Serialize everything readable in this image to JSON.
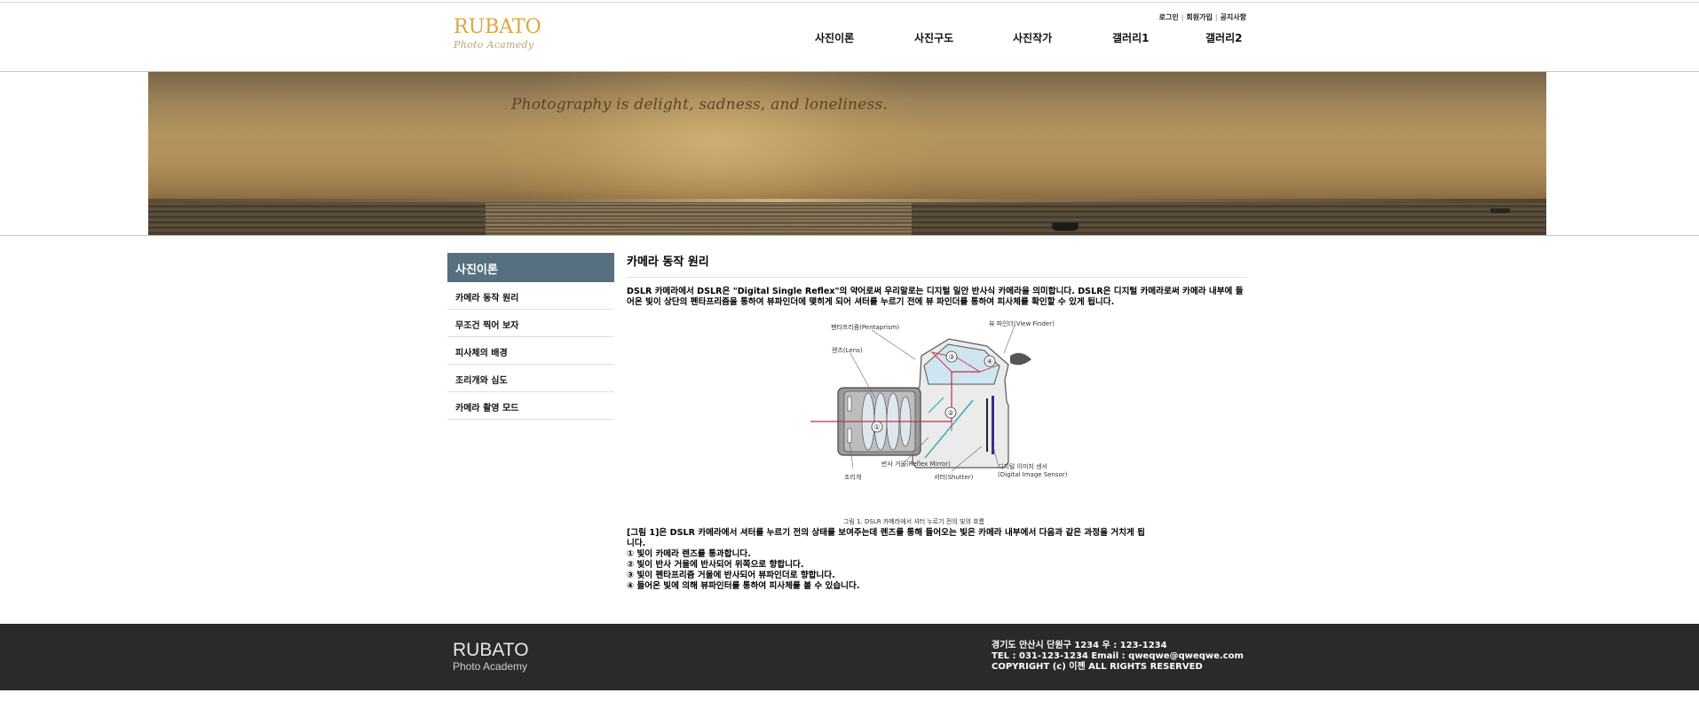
{
  "header": {
    "logo_main": "RUBATO",
    "logo_sub": "Photo Acamedy",
    "util_links": [
      "로그인",
      "회원가입",
      "공지사항"
    ],
    "nav": [
      "사진이론",
      "사진구도",
      "사진작가",
      "갤러리1",
      "갤러리2"
    ]
  },
  "banner": {
    "quote": "Photography is delight, sadness, and loneliness."
  },
  "sidebar": {
    "title": "사진이론",
    "items": [
      "카메라 동작 원리",
      "무조건 찍어 보자",
      "피사체의 배경",
      "조리개와 심도",
      "카메라 촬영 모드"
    ]
  },
  "main": {
    "title": "카메라 동작 원리",
    "intro": "DSLR 카메라에서 DSLR은 \"Digital Single Reflex\"의 약어로써 우리말로는 디지털 일안 반사식 카메라을 의미합니다. DSLR은 디지털 카메라로써 카메라 내부에 들어온 빛이 상단의 펜타프리즘을 통하여 뷰파인더에 맺히게 되어 셔터를 누르기 전에 뷰 파인더를 통하여 피사체를 확인할 수 있게 됩니다.",
    "figure": {
      "labels": {
        "pentaprism": "펜타프리즘(Pentaprism)",
        "viewfinder": "뷰 파인더(View Finder)",
        "lens": "렌즈(Lens)",
        "aperture": "조리개",
        "mirror": "반사 거울(Reflex Mirror)",
        "shutter": "셔터(Shutter)",
        "sensor_1": "디지털 이미지 센서",
        "sensor_2": "(Digital Image Sensor)"
      },
      "numbers": [
        "①",
        "②",
        "③",
        "④"
      ],
      "caption": "그림 1. DSLR 카메라에서 셔터 누르기 전의 빛의 흐름"
    },
    "desc_lines": [
      "[그림 1]은 DSLR 카메라에서 셔터를 누르기 전의 상태를 보여주는데 렌즈를 통해 들어오는 빛은 카메라 내부에서 다음과 같은 과정을 거치게 됩",
      "니다.",
      "① 빛이 카메라 렌즈를 통과합니다.",
      "② 빛이 반사 거울에 반사되어 위쪽으로 향합니다.",
      "③ 빛이 펜타프리즘 거울에 반사되어 뷰파인더로 향합니다.",
      "④ 들어온 빛에 의해 뷰파인터를 통하여 피사체를 볼 수 있습니다."
    ]
  },
  "footer": {
    "logo_main": "RUBATO",
    "logo_sub": "Photo Academy",
    "address": "경기도 안산시 단원구 1234 우 : 123-1234",
    "contact": "TEL : 031-123-1234 Email : qweqwe@qweqwe.com",
    "copyright": "COPYRIGHT (c) 이젠 ALL RIGHTS RESERVED"
  },
  "colors": {
    "logo_gold": "#d9a53c",
    "sidebar_title_bg": "#56707f",
    "footer_bg": "#2b2a28",
    "ray_red": "#d9263b",
    "ray_teal": "#3aa8b8",
    "prism_fill": "#cfe6f2"
  }
}
